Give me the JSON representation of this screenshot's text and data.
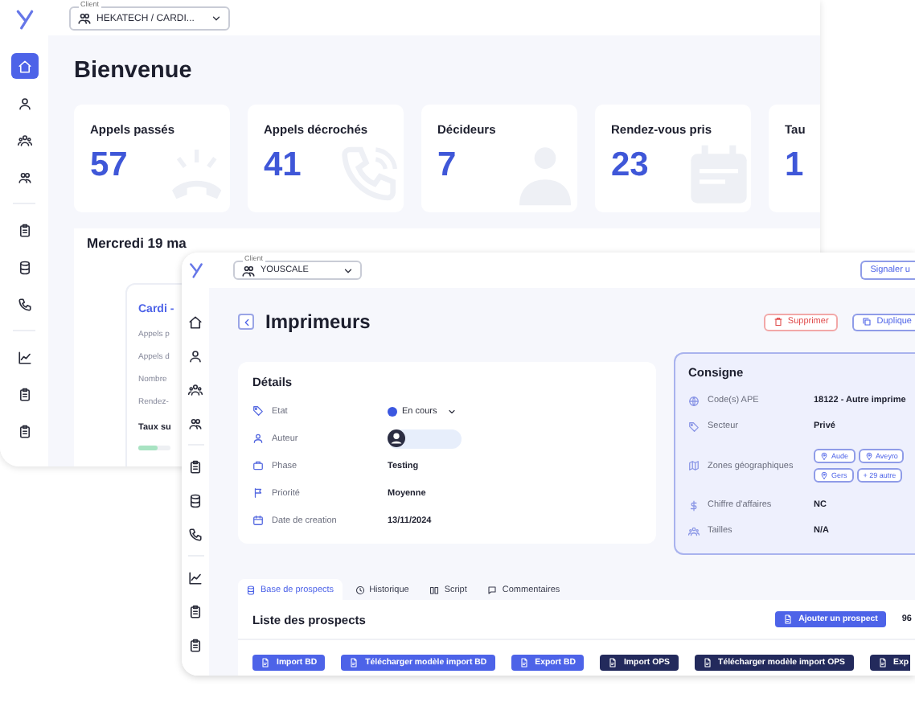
{
  "dashboard": {
    "sidebar": [
      {
        "items": [
          {
            "kind": "home",
            "selected": true
          },
          {
            "kind": "user",
            "selected": false
          },
          {
            "kind": "team",
            "selected": false
          },
          {
            "kind": "people",
            "selected": false
          }
        ]
      },
      {
        "items": [
          {
            "kind": "clipboard",
            "selected": false
          },
          {
            "kind": "database",
            "selected": false
          },
          {
            "kind": "phone",
            "selected": false
          }
        ]
      },
      {
        "items": [
          {
            "kind": "chart",
            "selected": false
          },
          {
            "kind": "clipboard",
            "selected": false
          },
          {
            "kind": "clipboard",
            "selected": false
          }
        ]
      }
    ],
    "client_select": {
      "label": "Client",
      "value": "HEKATECH / CARDI..."
    },
    "title": "Bienvenue",
    "stats": [
      {
        "label": "Appels passés",
        "value": "57",
        "kind": "phone-ring"
      },
      {
        "label": "Appels décrochés",
        "value": "41",
        "kind": "phone"
      },
      {
        "label": "Décideurs",
        "value": "7",
        "kind": "person"
      },
      {
        "label": "Rendez-vous pris",
        "value": "23",
        "kind": "calendar"
      },
      {
        "label": "Tau",
        "value": "1",
        "kind": "none"
      }
    ],
    "day": {
      "heading": "Mercredi 19 ma",
      "card": {
        "title": "Cardi -",
        "rows": [
          "Appels p",
          "Appels d",
          "Nombre",
          "Rendez-"
        ],
        "rate_label": "Taux su",
        "level": 0.6
      }
    }
  },
  "project": {
    "sidebar": [
      {
        "items": [
          {
            "kind": "home",
            "selected": false
          },
          {
            "kind": "user",
            "selected": false
          },
          {
            "kind": "team",
            "selected": false
          },
          {
            "kind": "people",
            "selected": false
          }
        ]
      },
      {
        "items": [
          {
            "kind": "clipboard",
            "selected": false
          },
          {
            "kind": "database",
            "selected": false
          },
          {
            "kind": "phone",
            "selected": false
          }
        ]
      },
      {
        "items": [
          {
            "kind": "chart",
            "selected": false
          },
          {
            "kind": "clipboard",
            "selected": false
          },
          {
            "kind": "clipboard",
            "selected": false
          }
        ]
      }
    ],
    "client_select": {
      "label": "Client",
      "value": "YOUSCALE"
    },
    "report_button": "Signaler u",
    "title": "Imprimeurs",
    "actions": [
      {
        "label": "Supprimer",
        "kind": "danger"
      },
      {
        "label": "Duplique",
        "kind": "outline"
      }
    ],
    "details": {
      "title": "Détails",
      "rows": [
        {
          "label": "Etat",
          "kind": "status",
          "value": "En cours",
          "color": "#3b57e0"
        },
        {
          "label": "Auteur",
          "kind": "avatar"
        },
        {
          "label": "Phase",
          "kind": "text",
          "value": "Testing"
        },
        {
          "label": "Priorité",
          "kind": "text",
          "value": "Moyenne"
        },
        {
          "label": "Date de creation",
          "kind": "text",
          "value": "13/11/2024"
        }
      ]
    },
    "consigne": {
      "title": "Consigne",
      "rows": [
        {
          "label": "Code(s) APE",
          "kind": "text",
          "value": "18122 - Autre imprime"
        },
        {
          "label": "Secteur",
          "kind": "text",
          "value": "Privé"
        },
        {
          "label": "Zones géographiques",
          "kind": "tags",
          "tags": [
            {
              "text": "Aude",
              "pin": true
            },
            {
              "text": "Aveyro",
              "pin": true
            },
            {
              "text": "Gers",
              "pin": true
            },
            {
              "text": "+ 29 autre",
              "pin": false
            }
          ]
        },
        {
          "label": "Chiffre d'affaires",
          "kind": "text",
          "value": "NC"
        },
        {
          "label": "Tailles",
          "kind": "text",
          "value": "N/A"
        }
      ]
    },
    "tabs": [
      {
        "label": "Base de prospects",
        "selected": true
      },
      {
        "label": "Historique",
        "selected": false
      },
      {
        "label": "Script",
        "selected": false
      },
      {
        "label": "Commentaires",
        "selected": false
      }
    ],
    "prospects": {
      "title": "Liste des prospects",
      "add_button": "Ajouter un prospect",
      "count": "96",
      "buttons": [
        {
          "label": "Import BD",
          "kind": "primary"
        },
        {
          "label": "Télécharger modèle import BD",
          "kind": "primary"
        },
        {
          "label": "Export BD",
          "kind": "primary"
        },
        {
          "label": "Import OPS",
          "kind": "dark"
        },
        {
          "label": "Télécharger modèle import OPS",
          "kind": "dark"
        },
        {
          "label": "Exp",
          "kind": "dark"
        }
      ]
    }
  }
}
